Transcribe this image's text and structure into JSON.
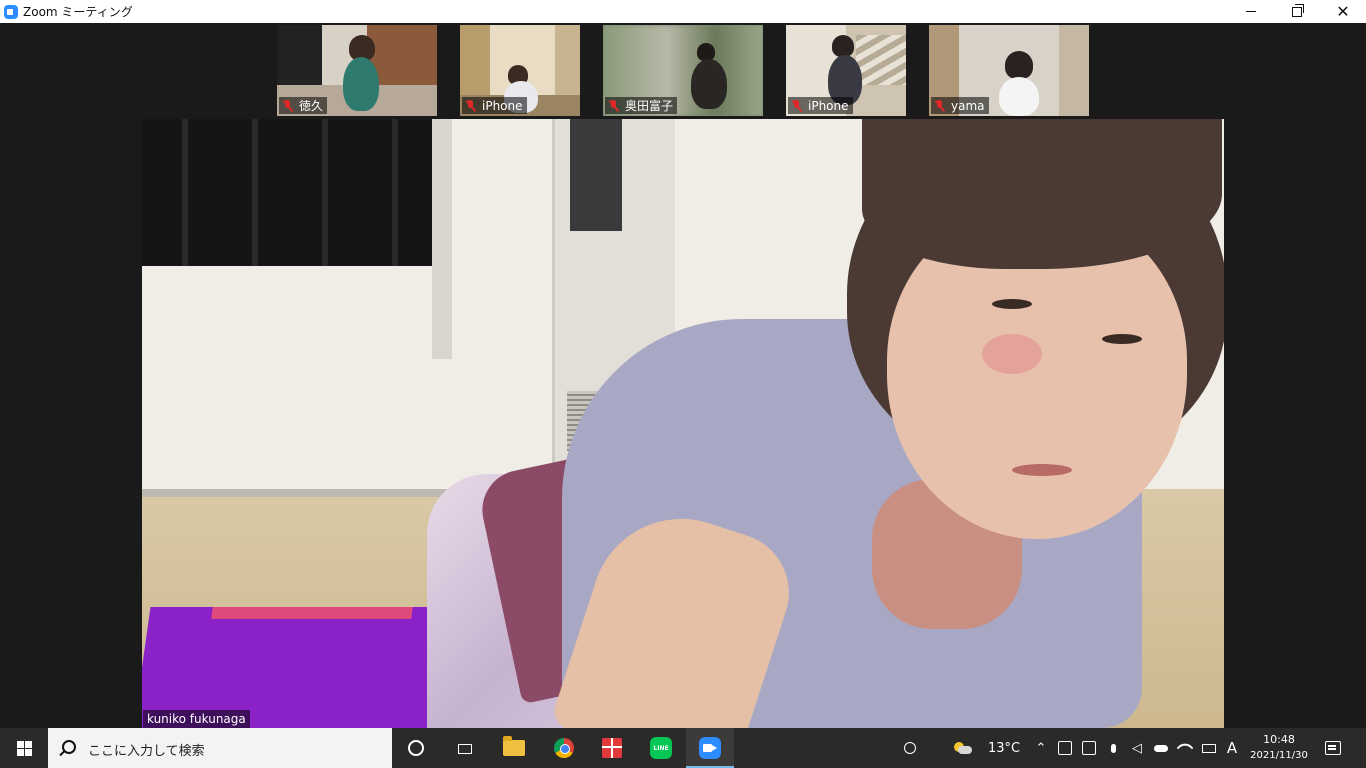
{
  "window": {
    "title": "Zoom ミーティング",
    "icon": "zoom-icon"
  },
  "thumbnails": [
    {
      "name": "徳久",
      "muted": true
    },
    {
      "name": "iPhone",
      "muted": true
    },
    {
      "name": "奥田富子",
      "muted": true
    },
    {
      "name": "iPhone",
      "muted": true
    },
    {
      "name": "yama",
      "muted": true
    }
  ],
  "main_video": {
    "speaker_name": "kuniko fukunaga"
  },
  "taskbar": {
    "search_placeholder": "ここに入力して検索",
    "apps": [
      "cortana-icon",
      "task-view-icon",
      "file-explorer-icon",
      "chrome-icon",
      "gift-icon",
      "line-icon",
      "zoom-icon"
    ],
    "line_label": "LINE",
    "weather_temp": "13°C",
    "ime_label": "A",
    "time": "10:48",
    "date": "2021/11/30"
  },
  "colors": {
    "zoom_blue": "#2d8cff",
    "mute_red": "#e02828",
    "taskbar_bg": "#2c2a28",
    "line_green": "#06c755"
  }
}
